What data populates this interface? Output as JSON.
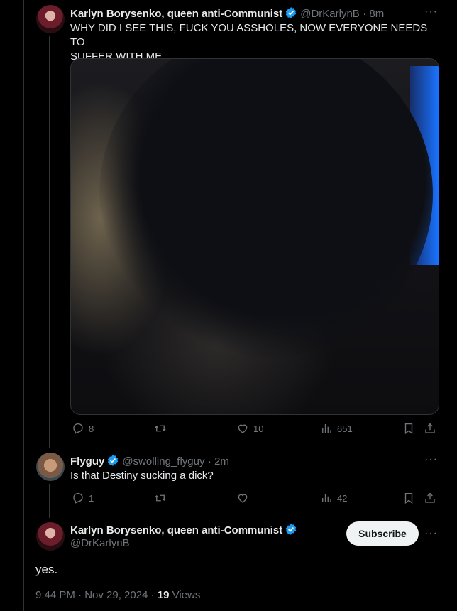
{
  "tweet1": {
    "name": "Karlyn Borysenko, queen anti-Communist",
    "handle": "@DrKarlynB",
    "time": "· 8m",
    "text_line1": "WHY DID I SEE THIS, FUCK YOU ASSHOLES, NOW EVERYONE NEEDS TO",
    "text_line2": "SUFFER WITH ME",
    "replies": "8",
    "retweets": "",
    "likes": "10",
    "views": "651"
  },
  "tweet2": {
    "name": "Flyguy",
    "handle": "@swolling_flyguy",
    "time": "· 2m",
    "text": "Is that Destiny sucking a dick?",
    "replies": "1",
    "retweets": "",
    "likes": "",
    "views": "42"
  },
  "main_tweet": {
    "name": "Karlyn Borysenko, queen anti-Communist",
    "handle": "@DrKarlynB",
    "subscribe_label": "Subscribe",
    "text": "yes.",
    "timestamp": "9:44 PM · Nov 29, 2024 · ",
    "views_count": "19",
    "views_label": " Views"
  },
  "icons": {
    "more": "more-icon",
    "verified": "verified-badge-icon",
    "reply": "reply-icon",
    "retweet": "retweet-icon",
    "like": "heart-icon",
    "views": "views-icon",
    "bookmark": "bookmark-icon",
    "share": "share-icon"
  },
  "colors": {
    "background": "#000000",
    "verified": "#1d9bf0",
    "muted": "#71767b",
    "text": "#e7e9ea"
  }
}
